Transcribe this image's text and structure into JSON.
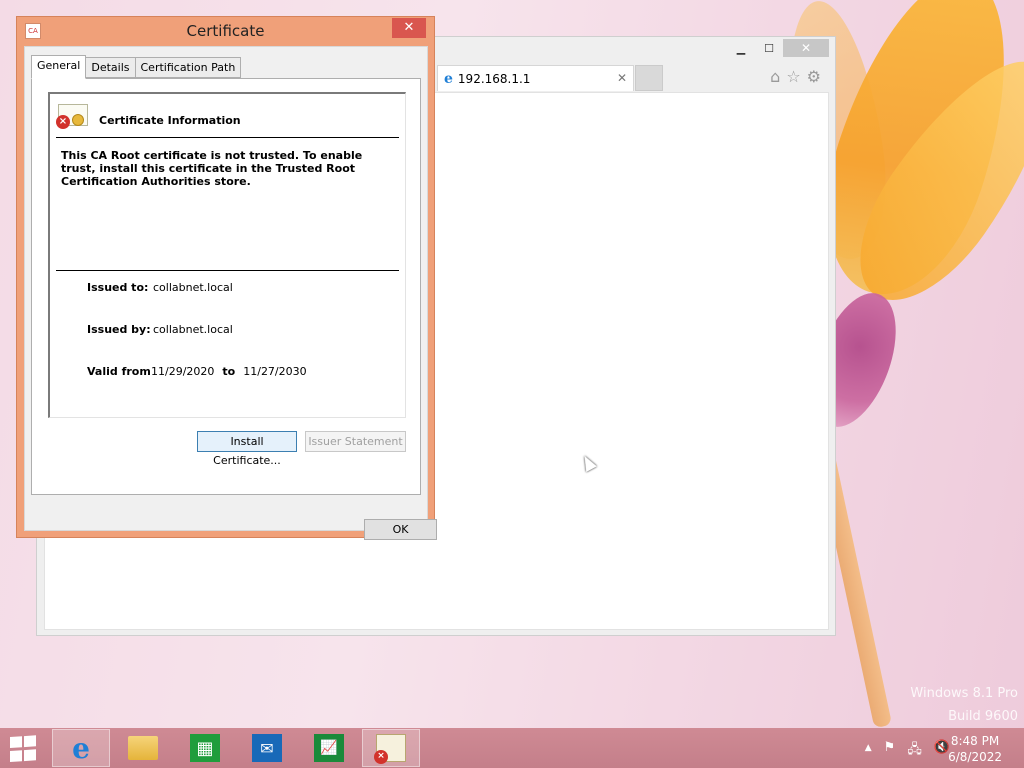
{
  "desktop": {
    "watermark_line1": "Windows 8.1 Pro",
    "watermark_line2": "Build 9600"
  },
  "browser": {
    "tab_title": "192.168.1.1",
    "tab_close": "✕",
    "minimize": "▁",
    "maximize": "☐",
    "close": "✕",
    "home_icon": "⌂",
    "favorites_icon": "☆",
    "settings_icon": "⚙"
  },
  "certificate_dialog": {
    "title": "Certificate",
    "close_label": "✕",
    "app_icon_text": "CA",
    "tabs": [
      {
        "label": "General",
        "active": true
      },
      {
        "label": "Details",
        "active": false
      },
      {
        "label": "Certification Path",
        "active": false
      }
    ],
    "info_title": "Certificate Information",
    "warning": "This CA Root certificate is not trusted. To enable trust, install this certificate in the Trusted Root Certification Authorities store.",
    "issued_to_label": "Issued to:",
    "issued_to_value": "collabnet.local",
    "issued_by_label": "Issued by:",
    "issued_by_value": "collabnet.local",
    "valid_from_label": "Valid from",
    "valid_from_value": "11/29/2020",
    "valid_to_label": "to",
    "valid_to_value": "11/27/2030",
    "install_button": "Install Certificate...",
    "issuer_button": "Issuer Statement",
    "ok_button": "OK"
  },
  "taskbar": {
    "ie_glyph": "e",
    "store_glyph": "▦",
    "mail_glyph": "✉",
    "finance_glyph": "📈",
    "tray_up": "▲",
    "tray_flag": "⚑",
    "tray_network": "🖧",
    "tray_volume": "🔇",
    "time": "8:48 PM",
    "date": "6/8/2022"
  },
  "colors": {
    "dialog_frame": "#f0a079",
    "dialog_close": "#d9564f",
    "taskbar": "#c8848f",
    "accent_button_border": "#3c7fb1"
  }
}
